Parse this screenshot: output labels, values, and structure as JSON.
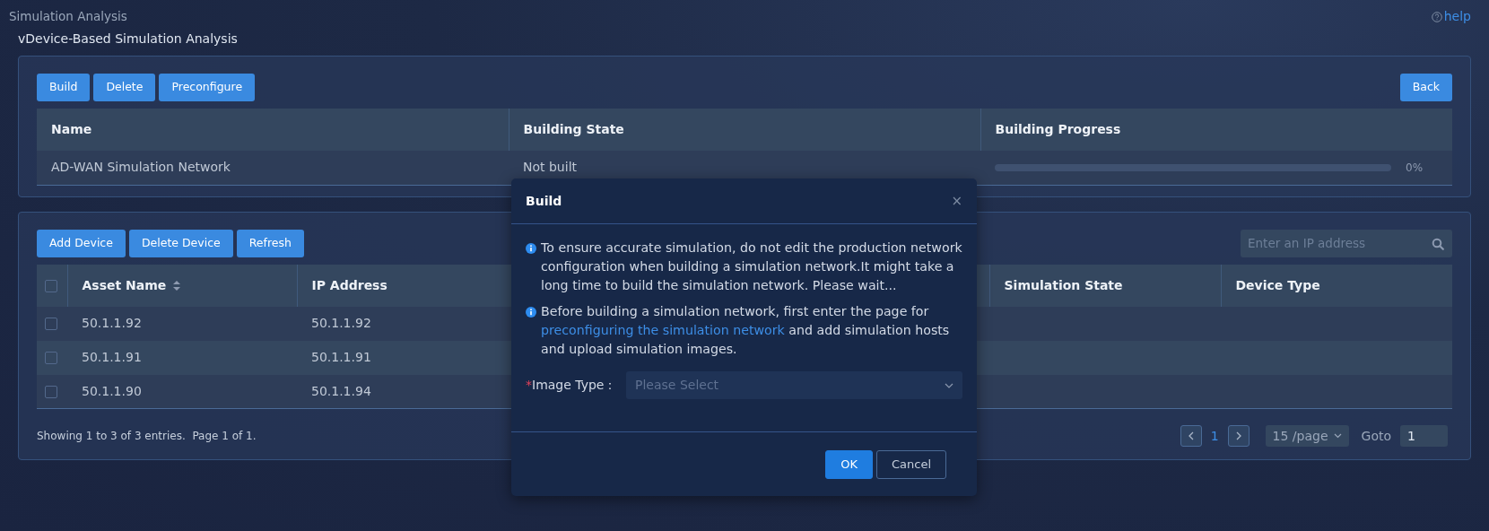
{
  "header": {
    "breadcrumb": "Simulation Analysis",
    "help": "help",
    "subtitle": "vDevice-Based Simulation Analysis"
  },
  "network_panel": {
    "buttons": [
      "Build",
      "Delete",
      "Preconfigure"
    ],
    "back_button": "Back",
    "columns": [
      "Name",
      "Building State",
      "Building Progress"
    ],
    "rows": [
      {
        "name": "AD-WAN Simulation Network",
        "state": "Not built",
        "level": 0,
        "progress": "0%"
      }
    ]
  },
  "device_panel": {
    "buttons": [
      "Add Device",
      "Delete Device",
      "Refresh"
    ],
    "search": {
      "placeholder": "Enter an IP address"
    },
    "select_all": {
      "checked": false
    },
    "columns": [
      {
        "label": "Asset Name",
        "sortable": true
      },
      {
        "label": "IP Address",
        "sortable": false
      },
      {
        "label": "Simulation State",
        "sortable": false
      },
      {
        "label": "Device Type",
        "sortable": false
      }
    ],
    "rows": [
      {
        "asset_name": "50.1.1.92",
        "ip_address": "50.1.1.92",
        "checked": false
      },
      {
        "asset_name": "50.1.1.91",
        "ip_address": "50.1.1.91",
        "checked": false
      },
      {
        "asset_name": "50.1.1.90",
        "ip_address": "50.1.1.94",
        "checked": false
      }
    ],
    "summary": "Showing 1 to 3 of 3 entries.  Page 1 of 1.",
    "pagination": {
      "pages": [
        {
          "label": "1",
          "selected": true
        }
      ],
      "page_size": "15 /page",
      "goto_label": "Goto",
      "goto_value": "1"
    }
  },
  "dialog": {
    "title": "Build",
    "close": "×",
    "notes": [
      {
        "text": "To ensure accurate simulation, do not edit the production network configuration when building a simulation network.It might take a long time to build the simulation network. Please wait..."
      },
      {
        "before": "Before building a simulation network, first enter the page for ",
        "link": "preconfiguring the simulation network",
        "after": " and add simulation hosts and upload simulation images."
      }
    ],
    "field": {
      "required_mark": "*",
      "label": "Image Type：",
      "placeholder": "Please Select"
    },
    "buttons": [
      {
        "label": "OK",
        "kind": "primary"
      },
      {
        "label": "Cancel",
        "kind": "secondary"
      }
    ]
  }
}
